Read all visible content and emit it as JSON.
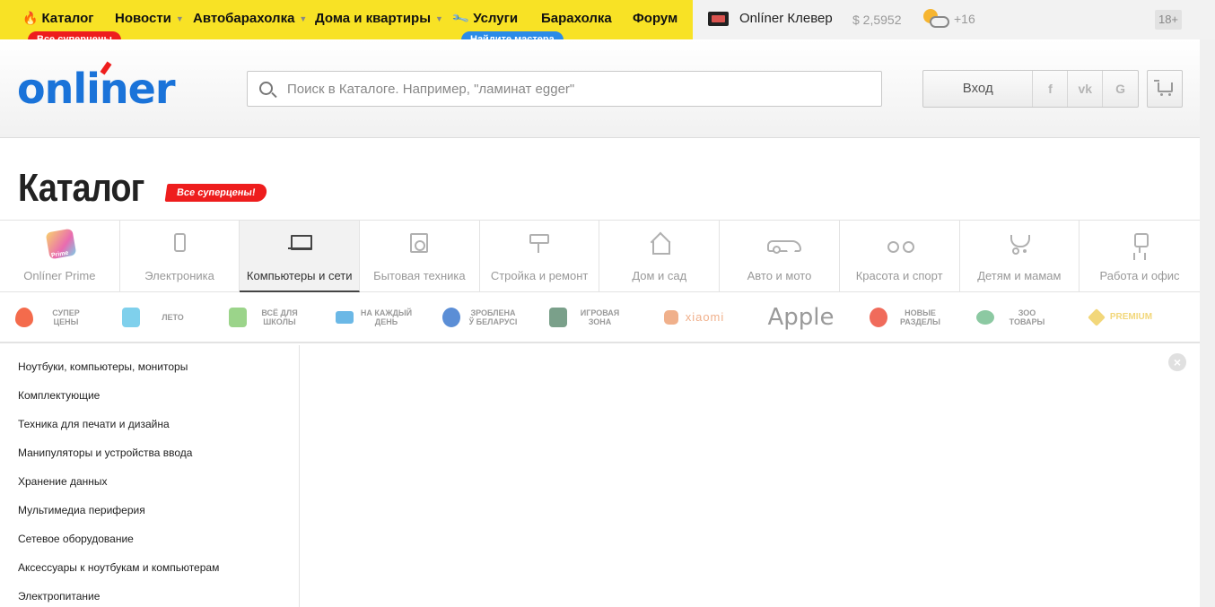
{
  "topnav": {
    "items": [
      {
        "label": "Каталог"
      },
      {
        "label": "Новости"
      },
      {
        "label": "Автобарахолка"
      },
      {
        "label": "Дома и квартиры"
      },
      {
        "label": "Услуги"
      },
      {
        "label": "Барахолка"
      },
      {
        "label": "Форум"
      }
    ],
    "catalog_badge": "Все суперцены",
    "services_badge": "Найдите мастера",
    "clever_label": "Onlíner Клевер",
    "rate": "$ 2,5952",
    "weather": "+16",
    "age_label": "18+"
  },
  "header": {
    "logo": "onliner",
    "search_placeholder": "Поиск в Каталоге. Например, \"ламинат egger\"",
    "login_label": "Вход",
    "social": [
      "f",
      "vk",
      "G"
    ]
  },
  "page": {
    "title": "Каталог",
    "title_badge": "Все суперцены!"
  },
  "categories": [
    {
      "label": "Onlíner Prime",
      "icon": "prime-icon"
    },
    {
      "label": "Электроника",
      "icon": "phone-icon"
    },
    {
      "label": "Компьютеры и сети",
      "icon": "laptop-icon",
      "active": true
    },
    {
      "label": "Бытовая техника",
      "icon": "washer-icon"
    },
    {
      "label": "Стройка и ремонт",
      "icon": "paint-roller-icon"
    },
    {
      "label": "Дом и сад",
      "icon": "house-icon"
    },
    {
      "label": "Авто и мото",
      "icon": "car-icon"
    },
    {
      "label": "Красота и спорт",
      "icon": "bicycle-icon"
    },
    {
      "label": "Детям и мамам",
      "icon": "stroller-icon"
    },
    {
      "label": "Работа и офис",
      "icon": "office-chair-icon"
    }
  ],
  "promos": [
    {
      "label": "СУПЕР ЦЕНЫ",
      "icon": "flame-icon",
      "color": "#f46b4c"
    },
    {
      "label": "ЛЕТО",
      "icon": "summer-icon",
      "color": "#7fd0ec"
    },
    {
      "label": "ВСЁ ДЛЯ ШКОЛЫ",
      "icon": "backpack-icon",
      "color": "#9bd48a"
    },
    {
      "label": "НА КАЖДЫЙ ДЕНЬ",
      "icon": "cart-icon",
      "color": "#6bb8e6"
    },
    {
      "label": "ЗРОБЛЕНА Ў БЕЛАРУСІ",
      "icon": "snowflake-icon",
      "color": "#5b8ed6"
    },
    {
      "label": "ИГРОВАЯ ЗОНА",
      "icon": "gamer-icon",
      "color": "#7aa08a"
    },
    {
      "label": "xiaomi",
      "icon": "xiaomi-logo",
      "color": "#f0b08b"
    },
    {
      "label": "Apple",
      "icon": "apple-logo",
      "color": "#9a9a9a"
    },
    {
      "label": "НОВЫЕ РАЗДЕЛЫ",
      "icon": "new-icon",
      "color": "#f06b5b"
    },
    {
      "label": "ЗОО ТОВАРЫ",
      "icon": "pet-food-icon",
      "color": "#8cc9a2"
    },
    {
      "label": "PREMIUM",
      "icon": "diamond-icon",
      "color": "#f2d77a"
    }
  ],
  "sidebar": {
    "items": [
      "Ноутбуки, компьютеры, мониторы",
      "Комплектующие",
      "Техника для печати и дизайна",
      "Манипуляторы и устройства ввода",
      "Хранение данных",
      "Мультимедиа периферия",
      "Сетевое оборудование",
      "Аксессуары к ноутбукам и компьютерам",
      "Электропитание"
    ]
  },
  "colors": {
    "topbar_yellow": "#f8e225",
    "brand_blue": "#1a73d9",
    "badge_red": "#ee1d1d",
    "badge_blue": "#2a8be8"
  }
}
